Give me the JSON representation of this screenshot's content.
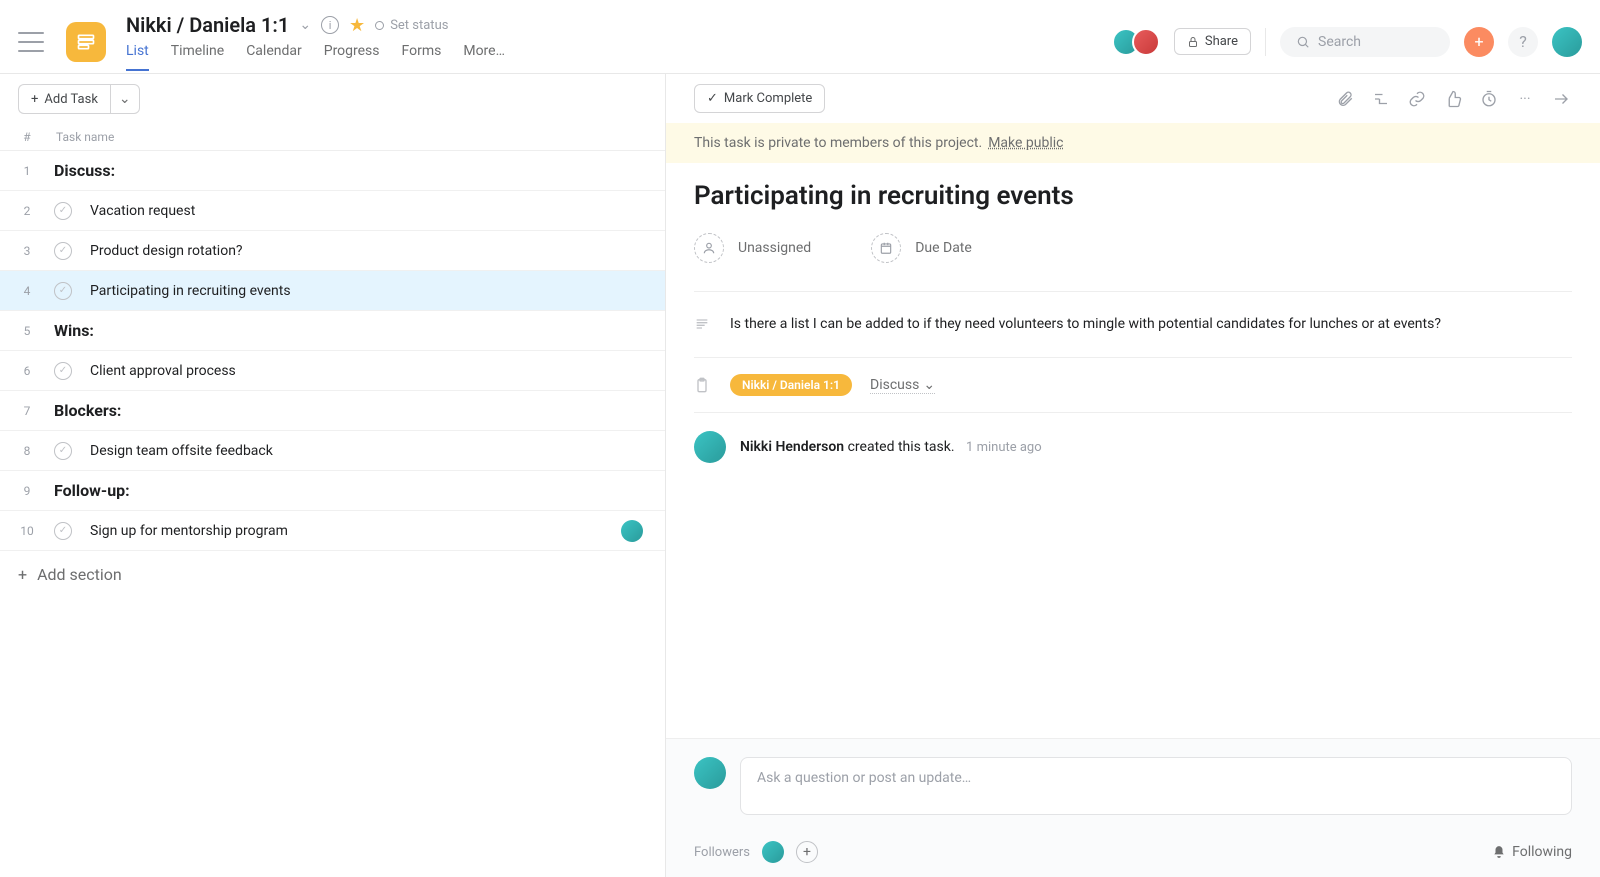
{
  "header": {
    "project_title": "Nikki / Daniela 1:1",
    "set_status_label": "Set status",
    "share_label": "Share",
    "search_placeholder": "Search",
    "tabs": [
      "List",
      "Timeline",
      "Calendar",
      "Progress",
      "Forms",
      "More…"
    ],
    "active_tab": 0
  },
  "left": {
    "add_task_label": "Add Task",
    "col_num": "#",
    "col_name": "Task name",
    "add_section_label": "Add section",
    "rows": [
      {
        "n": "1",
        "type": "section",
        "text": "Discuss:"
      },
      {
        "n": "2",
        "type": "task",
        "text": "Vacation request"
      },
      {
        "n": "3",
        "type": "task",
        "text": "Product design rotation?"
      },
      {
        "n": "4",
        "type": "task",
        "text": "Participating in recruiting events",
        "selected": true
      },
      {
        "n": "5",
        "type": "section",
        "text": "Wins:"
      },
      {
        "n": "6",
        "type": "task",
        "text": "Client approval process"
      },
      {
        "n": "7",
        "type": "section",
        "text": "Blockers:"
      },
      {
        "n": "8",
        "type": "task",
        "text": "Design team offsite feedback"
      },
      {
        "n": "9",
        "type": "section",
        "text": "Follow-up:"
      },
      {
        "n": "10",
        "type": "task",
        "text": "Sign up for mentorship program",
        "assignee": true
      }
    ]
  },
  "detail": {
    "mark_complete_label": "Mark Complete",
    "privacy_text": "This task is private to members of this project.",
    "privacy_link": "Make public",
    "title": "Participating in recruiting events",
    "unassigned_label": "Unassigned",
    "due_date_label": "Due Date",
    "description": "Is there a list I can be added to if they need volunteers to mingle with potential candidates for lunches or at events?",
    "project_pill": "Nikki / Daniela 1:1",
    "project_section": "Discuss",
    "activity_actor": "Nikki Henderson",
    "activity_verb": "created this task.",
    "activity_time": "1 minute ago",
    "comment_placeholder": "Ask a question or post an update…",
    "followers_label": "Followers",
    "following_label": "Following"
  }
}
